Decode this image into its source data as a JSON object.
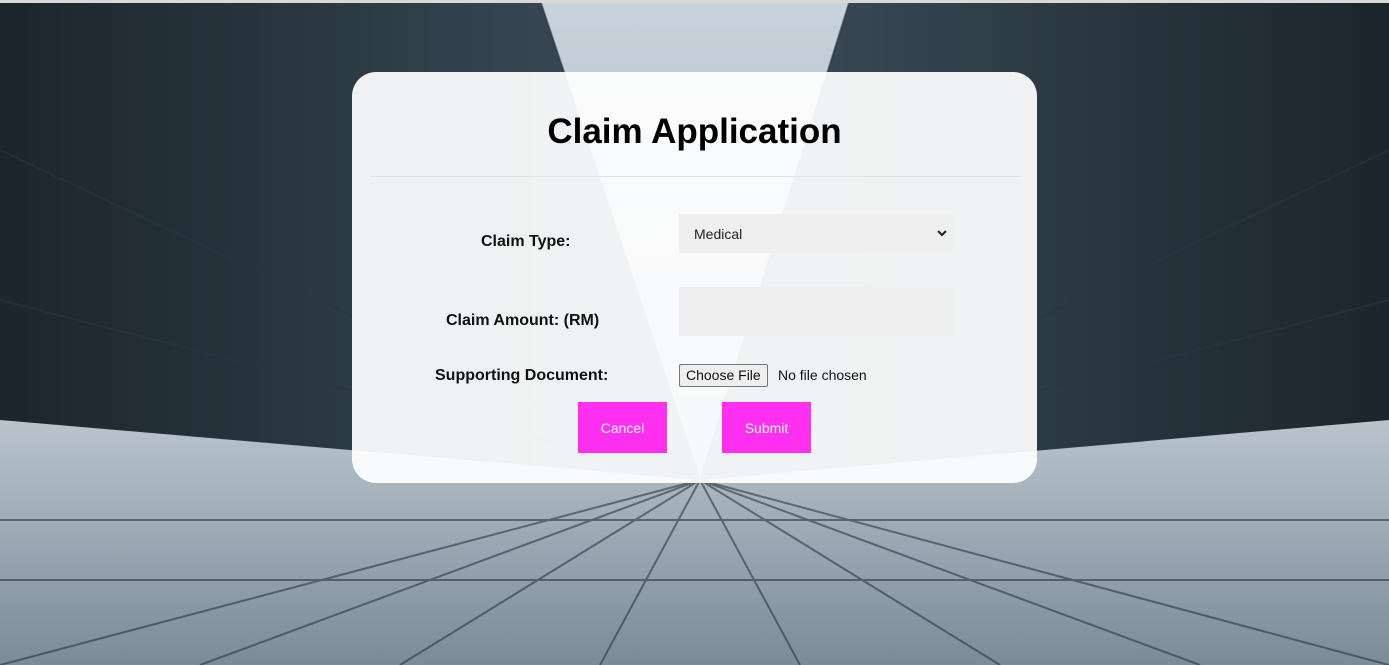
{
  "form": {
    "title": "Claim Application",
    "claim_type": {
      "label": "Claim Type:",
      "selected": "Medical"
    },
    "claim_amount": {
      "label": "Claim Amount: (RM)",
      "value": "",
      "placeholder": ""
    },
    "supporting_document": {
      "label": "Supporting Document:",
      "button_label": "Choose File",
      "status": "No file chosen"
    },
    "buttons": {
      "cancel": "Cancel",
      "submit": "Submit"
    }
  },
  "colors": {
    "accent": "#ff2ff2",
    "field_background": "#efefef",
    "card_background": "#ffffff"
  },
  "icons": {
    "select": "chevron-down-icon"
  }
}
